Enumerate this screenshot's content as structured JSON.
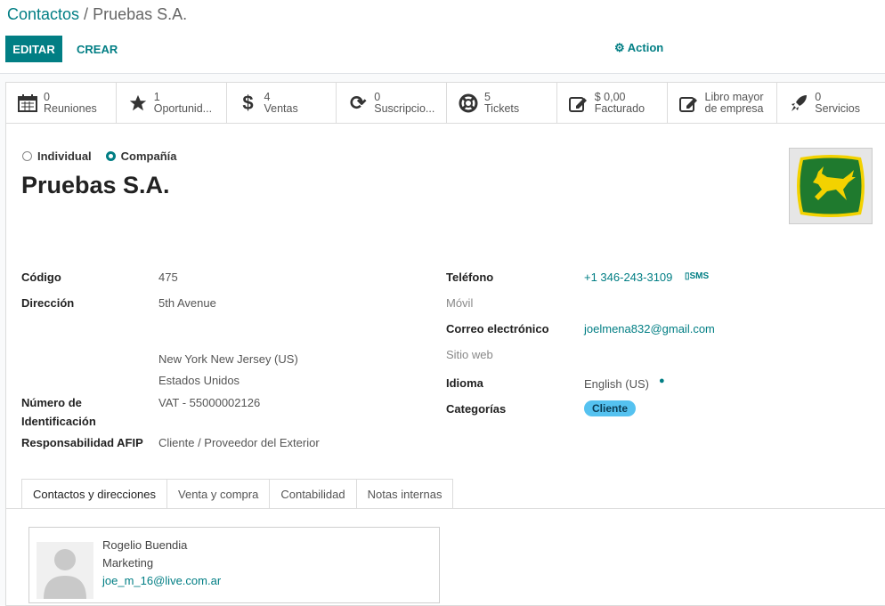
{
  "breadcrumb": {
    "parent": "Contactos",
    "separator": " / ",
    "current": "Pruebas S.A."
  },
  "toolbar": {
    "edit_label": "EDITAR",
    "create_label": "CREAR",
    "action_label": "Action"
  },
  "smart_buttons": [
    {
      "icon": "calendar-icon",
      "value": "0",
      "label": "Reuniones"
    },
    {
      "icon": "star-icon",
      "value": "1",
      "label": "Oportunid..."
    },
    {
      "icon": "dollar-icon",
      "value": "4",
      "label": "Ventas"
    },
    {
      "icon": "refresh-icon",
      "value": "0",
      "label": "Suscripcio..."
    },
    {
      "icon": "lifebuoy-icon",
      "value": "5",
      "label": "Tickets"
    },
    {
      "icon": "edit-icon",
      "value": "$ 0,00",
      "label": "Facturado"
    },
    {
      "icon": "edit-icon",
      "value": "Libro mayor",
      "label": "de empresa"
    },
    {
      "icon": "rocket-icon",
      "value": "0",
      "label": "Servicios"
    }
  ],
  "company_type": {
    "individual": "Individual",
    "company": "Compañía",
    "selected": "company"
  },
  "name": "Pruebas S.A.",
  "left_fields": {
    "code_label": "Código",
    "code_value": "475",
    "address_label": "Dirección",
    "street": "5th Avenue",
    "city_state": "New York  New Jersey (US)",
    "country": "Estados Unidos",
    "id_label_line1": "Número de",
    "id_label_line2": "Identificación",
    "id_value": "VAT - 55000002126",
    "afip_label": "Responsabilidad AFIP",
    "afip_value": "Cliente / Proveedor del Exterior"
  },
  "right_fields": {
    "phone_label": "Teléfono",
    "phone_value": "+1 346-243-3109",
    "sms_label": "SMS",
    "mobile_label": "Móvil",
    "email_label": "Correo electrónico",
    "email_value": "joelmena832@gmail.com",
    "website_label": "Sitio web",
    "language_label": "Idioma",
    "language_value": "English (US)",
    "categories_label": "Categorías",
    "category_tag": "Cliente"
  },
  "tabs": [
    "Contactos y direcciones",
    "Venta y compra",
    "Contabilidad",
    "Notas internas"
  ],
  "contact_card": {
    "name": "Rogelio Buendia",
    "role": "Marketing",
    "email": "joe_m_16@live.com.ar"
  },
  "colors": {
    "accent": "#017e84",
    "tag": "#55c2f0",
    "logo_green": "#1f7a2e",
    "logo_yellow": "#f3d200"
  }
}
